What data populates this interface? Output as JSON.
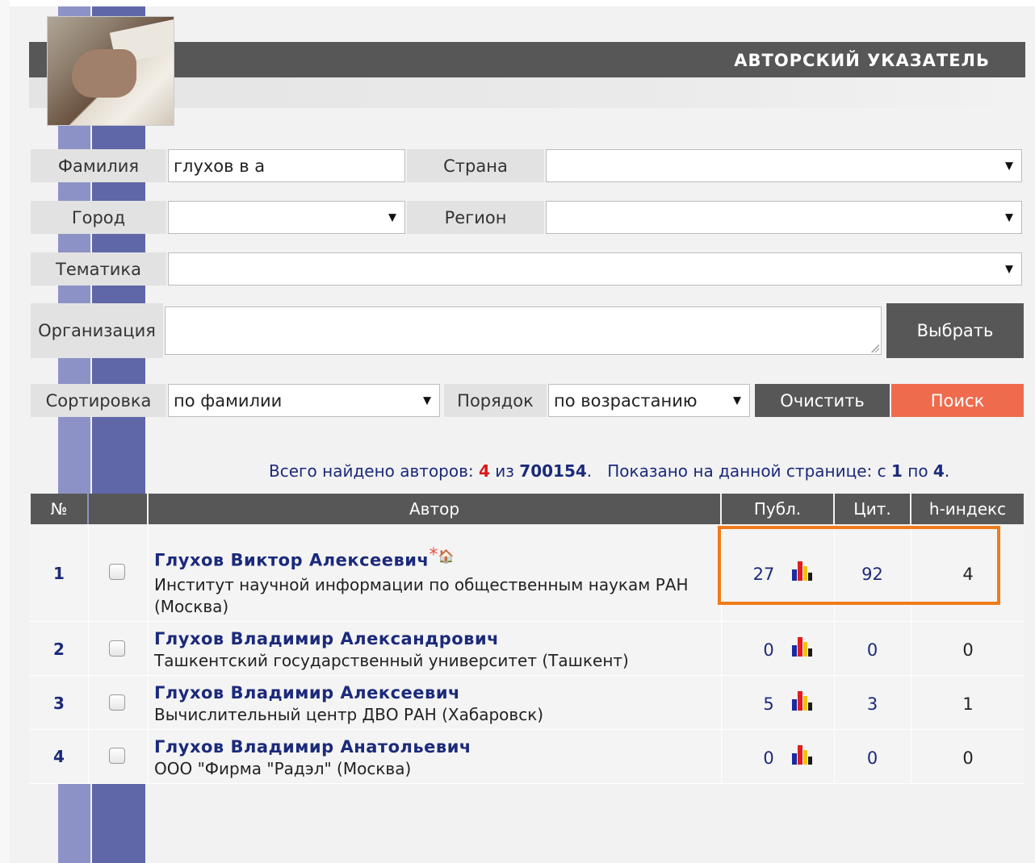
{
  "header": {
    "title": "АВТОРСКИЙ УКАЗАТЕЛЬ"
  },
  "form": {
    "surname_label": "Фамилия",
    "surname_value": "глухов в а",
    "country_label": "Страна",
    "country_value": "",
    "city_label": "Город",
    "city_value": "",
    "region_label": "Регион",
    "region_value": "",
    "topic_label": "Тематика",
    "topic_value": "",
    "org_label": "Организация",
    "org_value": "",
    "choose_button": "Выбрать",
    "sort_label": "Сортировка",
    "sort_value": "по фамилии",
    "order_label": "Порядок",
    "order_value": "по возрастанию",
    "clear_button": "Очистить",
    "search_button": "Поиск",
    "dropdown_arrow": "▼"
  },
  "summary": {
    "found_prefix": "Всего найдено авторов:",
    "found_count": "4",
    "of_text": "из",
    "total": "700154",
    "shown_prefix": ".   Показано на данной странице: с",
    "from": "1",
    "to_text": "по",
    "to": "4",
    "end": "."
  },
  "table": {
    "headers": {
      "num": "№",
      "author": "Автор",
      "pubs": "Публ.",
      "cites": "Цит.",
      "h_index": "h-индекс"
    },
    "rows": [
      {
        "num": "1",
        "name": "Глухов  Виктор  Алексеевич",
        "affiliation": "Институт научной информации по общественным наукам РАН (Москва)",
        "pubs": "27",
        "cites": "92",
        "h": "4",
        "star": "*",
        "home": "🏠"
      },
      {
        "num": "2",
        "name": "Глухов  Владимир  Александрович",
        "affiliation": "Ташкентский государственный университет (Ташкент)",
        "pubs": "0",
        "cites": "0",
        "h": "0"
      },
      {
        "num": "3",
        "name": "Глухов  Владимир  Алексеевич",
        "affiliation": "Вычислительный центр ДВО РАН (Хабаровск)",
        "pubs": "5",
        "cites": "3",
        "h": "1"
      },
      {
        "num": "4",
        "name": "Глухов  Владимир  Анатольевич",
        "affiliation": "ООО \"Фирма \"Радэл\" (Москва)",
        "pubs": "0",
        "cites": "0",
        "h": "0"
      }
    ]
  },
  "colors": {
    "accent_dark": "#575757",
    "search_orange": "#ef6b4e",
    "link_blue": "#1b2a7a",
    "highlight_box": "#f07b1b"
  }
}
